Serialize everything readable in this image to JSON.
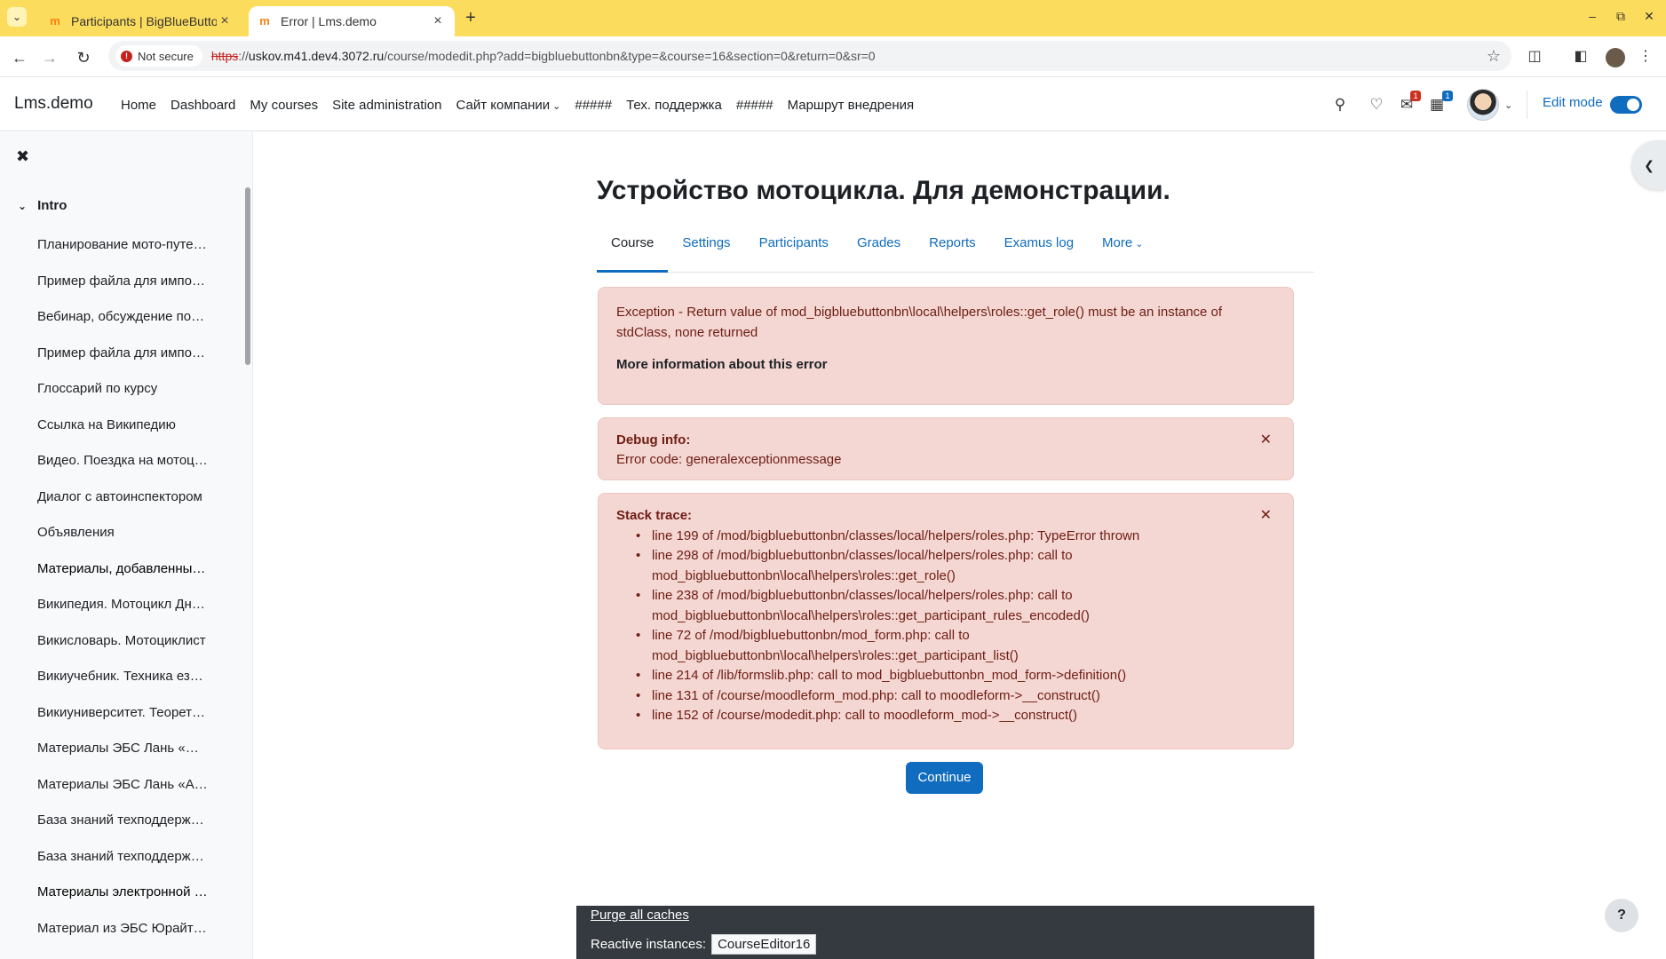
{
  "browser": {
    "tabs": [
      {
        "title": "Participants | BigBlueButto",
        "active": false
      },
      {
        "title": "Error | Lms.demo",
        "active": true
      }
    ],
    "security_label": "Not secure",
    "url_scheme": "https",
    "url_rest": "://",
    "url_host": "uskov.m41.dev4.3072.ru",
    "url_path": "/course/modedit.php?add=bigbluebuttonbn&type=&course=16&section=0&return=0&sr=0"
  },
  "navbar": {
    "brand": "Lms.demo",
    "items": [
      "Home",
      "Dashboard",
      "My courses",
      "Site administration",
      "Сайт компании",
      "#####",
      "Тех. поддержка",
      "#####",
      "Маршрут внедрения"
    ],
    "notification_count": "1",
    "message_count": "1",
    "edit_mode_label": "Edit mode"
  },
  "drawer": {
    "section": "Intro",
    "items": [
      "Планирование мото-путе…",
      "Пример файла для импо…",
      "Вебинар, обсуждение по…",
      "Пример файла для импо…",
      "Глоссарий по курсу",
      "Ссылка на Википедию",
      "Видео. Поездка на мотоц…",
      "Диалог с автоинспектором",
      "Объявления",
      "Материалы, добавленны…",
      "Википедия. Мотоцикл Дн…",
      "Викисловарь. Мотоциклист",
      "Викиучебник. Техника ез…",
      "Викиуниверситет. Теорет…",
      "Материалы ЭБС Лань «…",
      "Материалы ЭБС Лань «А…",
      "База знаний техподдерж…",
      "База знаний техподдерж…",
      "Материалы электронной …",
      "Материал из ЭБС Юрайт…"
    ]
  },
  "main": {
    "title": "Устройство мотоцикла. Для демонстрации.",
    "tabs": [
      "Course",
      "Settings",
      "Participants",
      "Grades",
      "Reports",
      "Examus log",
      "More"
    ],
    "error": {
      "message": "Exception - Return value of mod_bigbluebuttonbn\\local\\helpers\\roles::get_role() must be an instance of stdClass, none returned",
      "more_info": "More information about this error"
    },
    "debug": {
      "label": "Debug info:",
      "code": "Error code: generalexceptionmessage"
    },
    "stack": {
      "label": "Stack trace:",
      "lines": [
        "line 199 of /mod/bigbluebuttonbn/classes/local/helpers/roles.php: TypeError thrown",
        "line 298 of /mod/bigbluebuttonbn/classes/local/helpers/roles.php: call to mod_bigbluebuttonbn\\local\\helpers\\roles::get_role()",
        "line 238 of /mod/bigbluebuttonbn/classes/local/helpers/roles.php: call to mod_bigbluebuttonbn\\local\\helpers\\roles::get_participant_rules_encoded()",
        "line 72 of /mod/bigbluebuttonbn/mod_form.php: call to mod_bigbluebuttonbn\\local\\helpers\\roles::get_participant_list()",
        "line 214 of /lib/formslib.php: call to mod_bigbluebuttonbn_mod_form->definition()",
        "line 131 of /course/moodleform_mod.php: call to moodleform->__construct()",
        "line 152 of /course/modedit.php: call to moodleform_mod->__construct()"
      ]
    },
    "continue_label": "Continue"
  },
  "footer": {
    "purge_label": "Purge all caches",
    "reactive_label": "Reactive instances:",
    "reactive_button": "CourseEditor16"
  },
  "help_label": "?",
  "colors": {
    "chrome_tabbar": "#fcdc5c",
    "primary": "#0f6cbf",
    "alert_bg": "#f4d6d2",
    "alert_text": "#6e1d14",
    "footer_bg": "#343a40"
  }
}
